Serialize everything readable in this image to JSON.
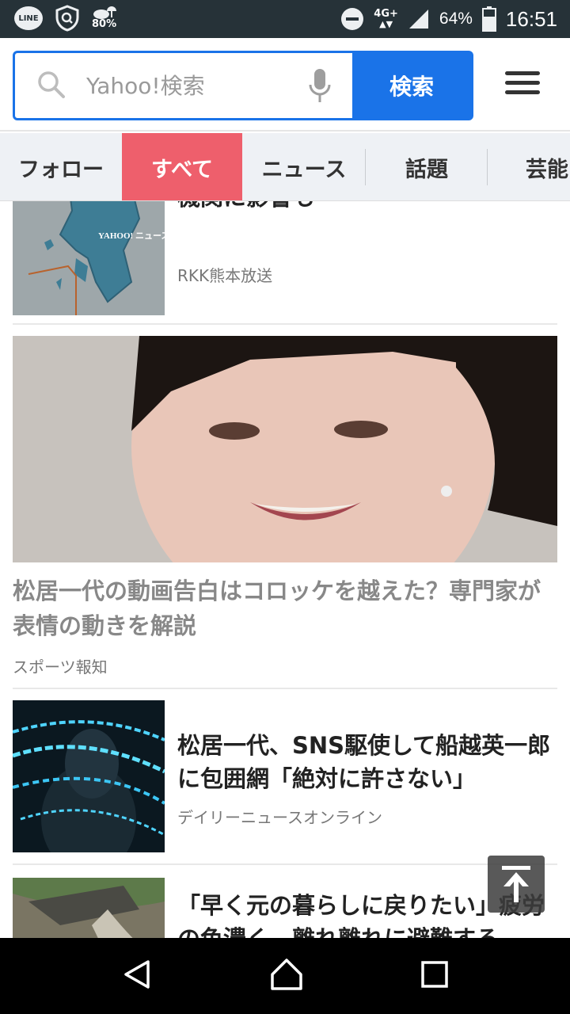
{
  "status_bar": {
    "line_label": "LINE",
    "weather_percent": "80%",
    "network": "4G+",
    "battery": "64%",
    "time": "16:51"
  },
  "search": {
    "placeholder": "Yahoo!検索",
    "button_label": "検索"
  },
  "tabs": [
    {
      "label": "フォロー",
      "active": false
    },
    {
      "label": "すべて",
      "active": true
    },
    {
      "label": "ニュース",
      "active": false
    },
    {
      "label": "話題",
      "active": false
    },
    {
      "label": "芸能",
      "active": false
    }
  ],
  "feed": {
    "items": [
      {
        "title": "大雨への警戒続く、川の増水や交通機関に影響も",
        "source": "RKK熊本放送",
        "map_label": "YAHOO! ニュース"
      },
      {
        "title": "松居一代の動画告白はコロッケを越えた？専門家が表情の動きを解説",
        "source": "スポーツ報知"
      },
      {
        "title": "松居一代、SNS駆使して船越英一郎に包囲網「絶対に許さない」",
        "source": "デイリーニュースオンライン"
      },
      {
        "title": "「早く元の暮らしに戻りたい」疲労の色濃く　離れ離れに避難する",
        "source": ""
      }
    ]
  },
  "colors": {
    "accent_blue": "#1a73e8",
    "active_tab": "#ee5f6c",
    "status_bar": "#263238"
  }
}
